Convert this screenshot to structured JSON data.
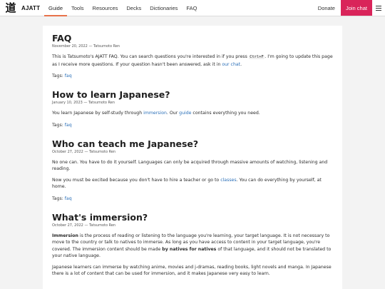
{
  "nav": {
    "logo_glyph": "道",
    "brand": "AJATT",
    "links": [
      "Guide",
      "Tools",
      "Resources",
      "Decks",
      "Dictionaries",
      "FAQ"
    ],
    "active": "Guide",
    "donate": "Donate",
    "join": "Join chat",
    "accent_color": "#d9245a",
    "active_underline_color": "#e8724a",
    "menu_icon": "hamburger-icon"
  },
  "entries": [
    {
      "title": "FAQ",
      "meta": "November 20, 2022 — Tatsumoto Ren",
      "p1_a": "This is Tatsumoto's AJATT FAQ. You can search questions you're interested in if you press ",
      "p1_code": "Ctrl+F",
      "p1_b": ". I'm going to update this page as I receive more questions. If your question hasn't been answered, ask it in ",
      "p1_link": "our chat",
      "p1_c": ".",
      "tags_label": "Tags: ",
      "tag": "faq"
    },
    {
      "title": "How to learn Japanese?",
      "meta": "January 10, 2023 — Tatsumoto Ren",
      "p1_a": "You learn Japanese by self-study through ",
      "p1_link1": "immersion",
      "p1_b": ". Our ",
      "p1_link2": "guide",
      "p1_c": " contains everything you need.",
      "tags_label": "Tags: ",
      "tag": "faq"
    },
    {
      "title": "Who can teach me Japanese?",
      "meta": "October 27, 2022 — Tatsumoto Ren",
      "p1": "No one can. You have to do it yourself. Languages can only be acquired through massive amounts of watching, listening and reading.",
      "p2_a": "Now you must be excited because you don't have to hire a teacher or go to ",
      "p2_link": "classes",
      "p2_b": ". You can do everything by yourself, at home.",
      "tags_label": "Tags: ",
      "tag": "faq"
    },
    {
      "title": "What's immersion?",
      "meta": "October 27, 2022 — Tatsumoto Ren",
      "p1_strong": "Immersion",
      "p1_a": " is the process of reading or listening to the language you're learning, your target language. It is not necessary to move to the country or talk to natives to immerse. As long as you have access to content in your target language, you're covered. The immersion content should be made ",
      "p1_strong2": "by natives for natives",
      "p1_b": " of that language, and it should not be translated to your native language.",
      "p2": "Japanese learners can immerse by watching anime, movies and j-dramas, reading books, light novels and manga. In Japanese there is a lot of content that can be used for immersion, and it makes Japanese very easy to learn."
    }
  ]
}
